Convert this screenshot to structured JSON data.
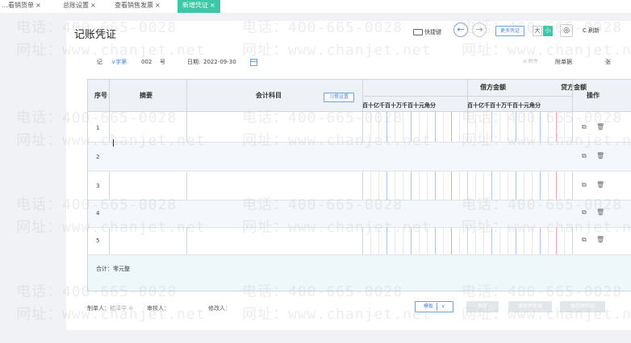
{
  "tabs": [
    {
      "label": "…看销货单",
      "active": false
    },
    {
      "label": "总账设置",
      "active": false
    },
    {
      "label": "查看销售发票",
      "active": false
    },
    {
      "label": "新增凭证",
      "active": true
    }
  ],
  "tab_close": "×",
  "page_title": "记账凭证",
  "toolbar": {
    "shortcut_label": "快捷键",
    "prev_icon": "←",
    "next_icon": "→",
    "more_voucher": "更多凭证",
    "size_big": "大",
    "size_small": "小",
    "eye_icon": "◎",
    "refresh_label": "C 刷新"
  },
  "voucher": {
    "type": "记",
    "type_suffix": "∨字第",
    "number": "002",
    "number_unit": "号",
    "date_label": "日期:",
    "date": "2022-09-30",
    "attachment_label": "⊘ 附件",
    "attachment_count_label": "附单据",
    "attachment_unit": "张"
  },
  "table": {
    "col_index": "序号",
    "col_summary": "摘要",
    "col_account": "会计科目",
    "hint_button": "习惯设置",
    "col_debit": "借方金额",
    "col_credit": "贷方金额",
    "col_action": "操作",
    "digit_units": "百十亿千百十万千百十元角分",
    "rows": [
      {
        "index": "1"
      },
      {
        "index": "2"
      },
      {
        "index": "3"
      },
      {
        "index": "4"
      },
      {
        "index": "5"
      }
    ],
    "copy_icon": "⧉",
    "delete_icon": "🗑",
    "total_label": "合计：零元整"
  },
  "footer": {
    "creator_label": "制单人：",
    "creator": "嵇泽华 ⊘",
    "auditor_label": "审核人：",
    "modifier_label": "修改人：",
    "template_button": "模板",
    "template_chevron": "∨",
    "save_button": "保存",
    "save_new_button": "保存并新增",
    "save_print_button": "保存并打印"
  },
  "watermark": {
    "phone": "电话：400-665-0028",
    "site": "网址：www.chanjet.net"
  },
  "colors": {
    "accent": "#3cc7a6",
    "blue": "#4a86d8",
    "header_bg": "#eef1f5"
  }
}
